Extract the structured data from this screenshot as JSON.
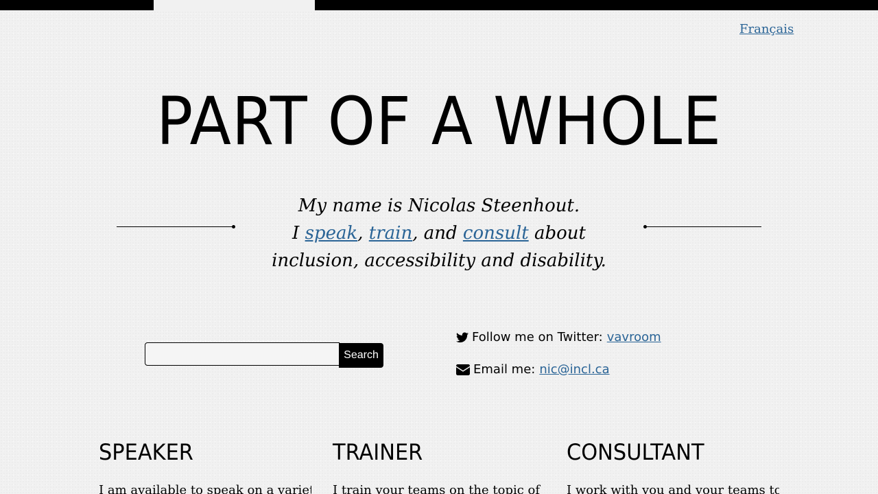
{
  "header": {
    "language_link": "Français"
  },
  "hero": {
    "title": "PART OF A WHOLE",
    "tagline": {
      "line1": "My name is Nicolas Steenhout.",
      "prefix": "I ",
      "speak": "speak",
      "sep1": ", ",
      "train": "train",
      "sep2": ", and ",
      "consult": "consult",
      "suffix": " about",
      "line3": "inclusion, accessibility and disability."
    }
  },
  "search": {
    "placeholder": "",
    "button_label": "Search"
  },
  "contact": {
    "twitter_label": "Follow me on Twitter:",
    "twitter_handle": "vavroom",
    "email_label": "Email me:",
    "email_address": "nic@incl.ca"
  },
  "services": [
    {
      "title": "SPEAKER",
      "text": "I am available to speak on a variety"
    },
    {
      "title": "TRAINER",
      "text": "I train your teams on the topic of"
    },
    {
      "title": "CONSULTANT",
      "text": "I work with you and your teams to"
    }
  ],
  "colors": {
    "link": "#2a6496",
    "text": "#000000",
    "background": "#f1f1f1"
  }
}
